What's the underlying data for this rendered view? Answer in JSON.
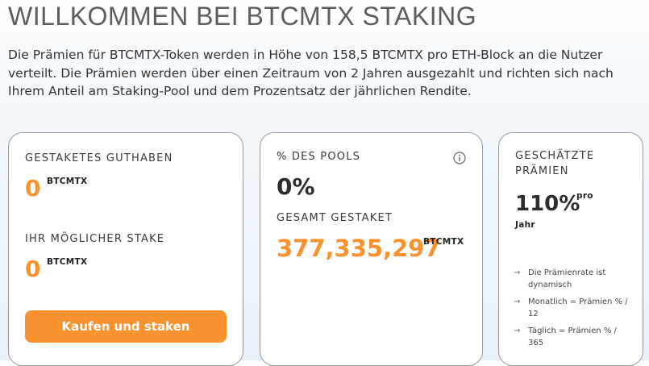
{
  "header": {
    "title": "WILLKOMMEN BEI BTCMTX STAKING",
    "intro": "Die Prämien für BTCMTX-Token werden in Höhe von 158,5 BTCMTX pro ETH-Block an die Nutzer verteilt. Die Prämien werden über einen Zeitraum von 2 Jahren ausgezahlt und richten sich nach Ihrem Anteil am Staking-Pool und dem Prozentsatz der jährlichen Rendite."
  },
  "balance_card": {
    "staked_label": "GESTAKETES GUTHABEN",
    "staked_value": "0",
    "staked_unit": "BTCMTX",
    "possible_label": "IHR MÖGLICHER STAKE",
    "possible_value": "0",
    "possible_unit": "BTCMTX",
    "buy_button": "Kaufen und staken"
  },
  "pool_card": {
    "pool_label": "% DES POOLS",
    "pool_value": "0%",
    "total_label": "GESAMT GESTAKET",
    "total_value": "377,335,297",
    "total_unit": "BTCMTX",
    "info_icon": "info-icon"
  },
  "rewards_card": {
    "label_line1": "GESCHÄTZTE",
    "label_line2": "PRÄMIEN",
    "value": "110%",
    "value_suffix": "pro",
    "value_period": "Jahr",
    "notes": [
      "Die Prämienrate ist dynamisch",
      "Monatlich = Prämien % / 12",
      "Täglich = Prämien % / 365"
    ]
  },
  "colors": {
    "accent": "#f7922f",
    "text": "#3e3e3e",
    "border": "#9b9b9b"
  }
}
